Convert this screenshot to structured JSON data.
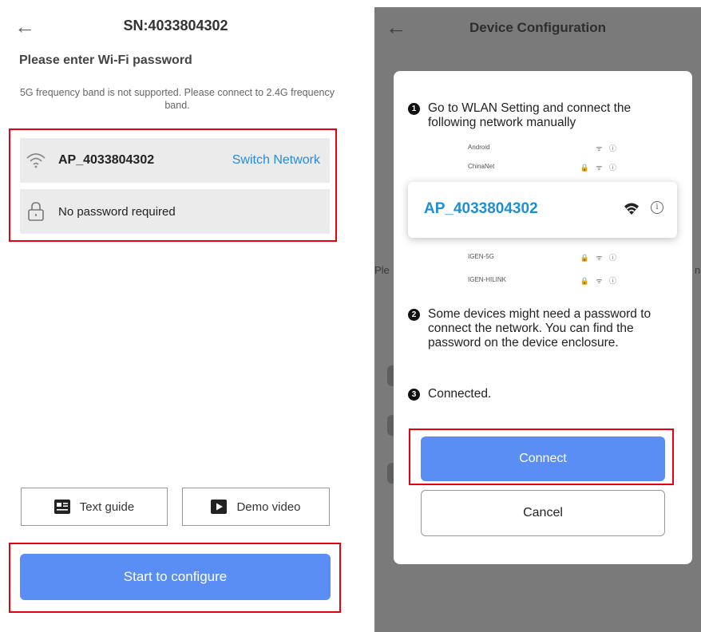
{
  "left": {
    "title": "SN:4033804302",
    "heading": "Please enter Wi-Fi password",
    "note": "5G frequency band is not supported. Please connect to 2.4G frequency band.",
    "network_name": "AP_4033804302",
    "switch_label": "Switch Network",
    "password_text": "No password required",
    "text_guide_label": "Text guide",
    "demo_video_label": "Demo video",
    "start_label": "Start to configure"
  },
  "right": {
    "title": "Device Configuration",
    "background_peek_left": "Ple",
    "background_peek_right": "n",
    "step1_number": "1",
    "step1_text": "Go to WLAN Setting and connect the following network manually",
    "step2_number": "2",
    "step2_text": "Some devices might need a password to connect the network. You can find the password on the device enclosure.",
    "step3_number": "3",
    "step3_text": "Connected.",
    "wifi_list": [
      {
        "name": "Android",
        "icons": "ᯤ ⓘ"
      },
      {
        "name": "ChinaNet",
        "icons": "🔒 ᯤ ⓘ"
      },
      {
        "name": "IGEN-5G",
        "icons": "🔒 ᯤ ⓘ"
      },
      {
        "name": "IGEN-HILINK",
        "icons": "🔒 ᯤ ⓘ"
      }
    ],
    "ap_name": "AP_4033804302",
    "info_glyph": "i",
    "connect_label": "Connect",
    "cancel_label": "Cancel"
  },
  "colors": {
    "accent_blue": "#5b8ef4",
    "link_blue": "#2b8ad8",
    "highlight_red": "#e60012",
    "overlay_gray": "#7a7a7a"
  },
  "icons": {
    "back": "left-arrow-icon",
    "wifi": "wifi-icon",
    "lock": "lock-icon",
    "text_guide": "document-icon",
    "demo_video": "play-icon",
    "info": "info-icon"
  }
}
